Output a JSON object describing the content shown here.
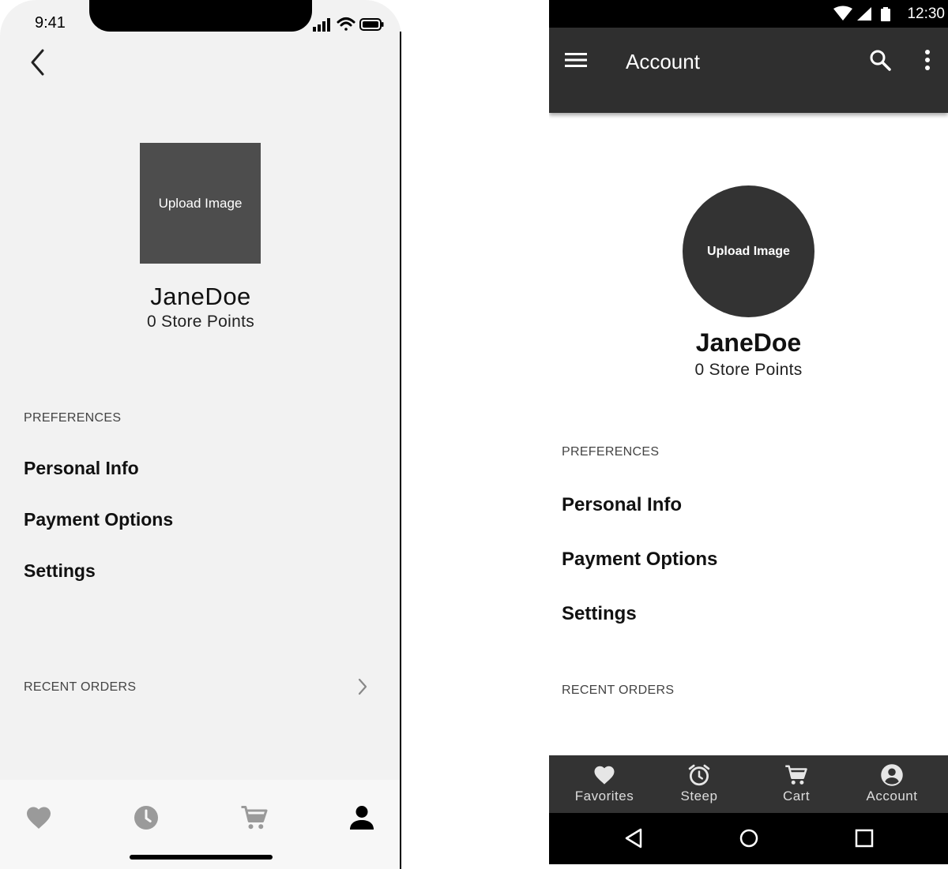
{
  "ios": {
    "status_time": "9:41",
    "profile": {
      "upload_label": "Upload Image",
      "username": "JaneDoe",
      "points": "0 Store Points"
    },
    "preferences_label": "PREFERENCES",
    "menu": [
      "Personal Info",
      "Payment Options",
      "Settings"
    ],
    "recent_orders_label": "RECENT ORDERS",
    "tabs": [
      "heart-icon",
      "clock-icon",
      "cart-icon",
      "person-icon"
    ]
  },
  "android": {
    "status_time": "12:30",
    "appbar_title": "Account",
    "profile": {
      "upload_label": "Upload Image",
      "username": "JaneDoe",
      "points": "0 Store Points"
    },
    "preferences_label": "PREFERENCES",
    "menu": [
      "Personal Info",
      "Payment Options",
      "Settings"
    ],
    "recent_orders_label": "RECENT ORDERS",
    "bottom_nav": [
      {
        "label": "Favorites",
        "icon": "heart-icon"
      },
      {
        "label": "Steep",
        "icon": "alarm-icon"
      },
      {
        "label": "Cart",
        "icon": "cart-icon"
      },
      {
        "label": "Account",
        "icon": "account-circle-icon"
      }
    ],
    "system_nav": [
      "back-icon",
      "home-icon",
      "recents-icon"
    ]
  },
  "colors": {
    "ios_bg": "#f2f2f2",
    "avatar_gray": "#4d4d4d",
    "android_appbar": "#2f2f2f",
    "android_nav": "#333333"
  }
}
